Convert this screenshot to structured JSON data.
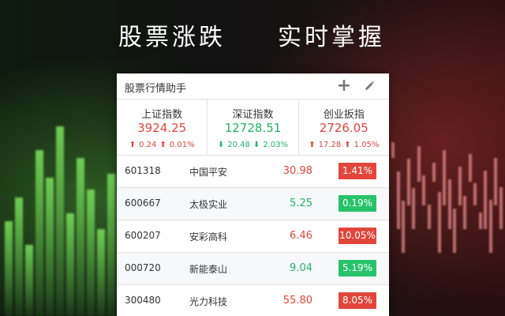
{
  "hero": {
    "left_text": "股票涨跌",
    "right_text": "实时掌握"
  },
  "panel": {
    "title": "股票行情助手",
    "add_icon": "plus-icon",
    "edit_icon": "pencil-icon"
  },
  "indices": [
    {
      "name": "上证指数",
      "value": "3924.25",
      "change": "0.24",
      "percent": "0.01%",
      "direction": "up"
    },
    {
      "name": "深证指数",
      "value": "12728.51",
      "change": "20.48",
      "percent": "2.03%",
      "direction": "down"
    },
    {
      "name": "创业扳指",
      "value": "2726.05",
      "change": "17.28",
      "percent": "1.05%",
      "direction": "up"
    }
  ],
  "stocks": [
    {
      "code": "601318",
      "name": "中国平安",
      "price": "30.98",
      "percent": "1.41%",
      "direction": "up"
    },
    {
      "code": "600667",
      "name": "太极实业",
      "price": "5.25",
      "percent": "0.19%",
      "direction": "down"
    },
    {
      "code": "600207",
      "name": "安彩高科",
      "price": "6.46",
      "percent": "10.05%",
      "direction": "up"
    },
    {
      "code": "000720",
      "name": "新能泰山",
      "price": "9.04",
      "percent": "5.19%",
      "direction": "down"
    },
    {
      "code": "300480",
      "name": "光力科技",
      "price": "55.80",
      "percent": "8.05%",
      "direction": "up"
    }
  ],
  "colors": {
    "up": "#e2463b",
    "down": "#20b368",
    "badge_down": "#27c36a"
  }
}
